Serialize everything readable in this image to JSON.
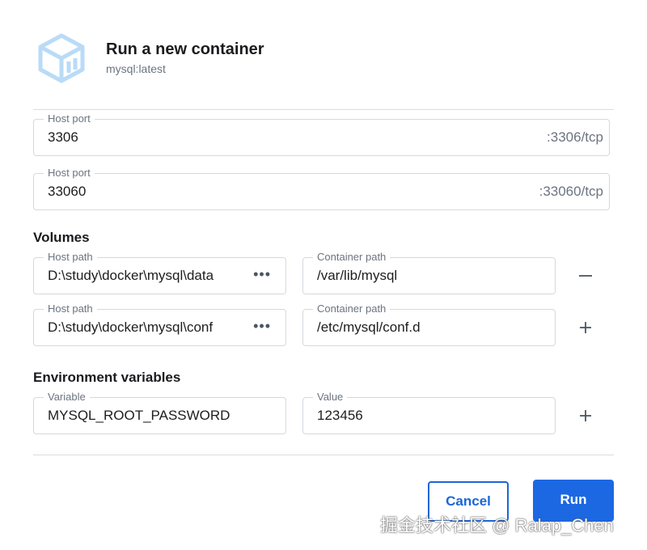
{
  "header": {
    "title": "Run a new container",
    "subtitle": "mysql:latest"
  },
  "ports": [
    {
      "label": "Host port",
      "value": "3306",
      "suffix": ":3306/tcp"
    },
    {
      "label": "Host port",
      "value": "33060",
      "suffix": ":33060/tcp"
    }
  ],
  "volumes": {
    "title": "Volumes",
    "rows": [
      {
        "host_label": "Host path",
        "host_value": "D:\\study\\docker\\mysql\\data",
        "container_label": "Container path",
        "container_value": "/var/lib/mysql",
        "action": "minus-icon"
      },
      {
        "host_label": "Host path",
        "host_value": "D:\\study\\docker\\mysql\\conf",
        "container_label": "Container path",
        "container_value": "/etc/mysql/conf.d",
        "action": "plus-icon"
      }
    ],
    "browse_glyph": "•••"
  },
  "env": {
    "title": "Environment variables",
    "rows": [
      {
        "var_label": "Variable",
        "var_value": "MYSQL_ROOT_PASSWORD",
        "val_label": "Value",
        "val_value": "123456",
        "action": "plus-icon"
      }
    ]
  },
  "footer": {
    "cancel_label": "Cancel",
    "run_label": "Run"
  },
  "watermark": "掘金技术社区 @ Ralap_Chen",
  "colors": {
    "accent": "#1c68e3",
    "logo": "#b9dbf7",
    "border": "#d4d9df",
    "muted_text": "#6b7480"
  }
}
